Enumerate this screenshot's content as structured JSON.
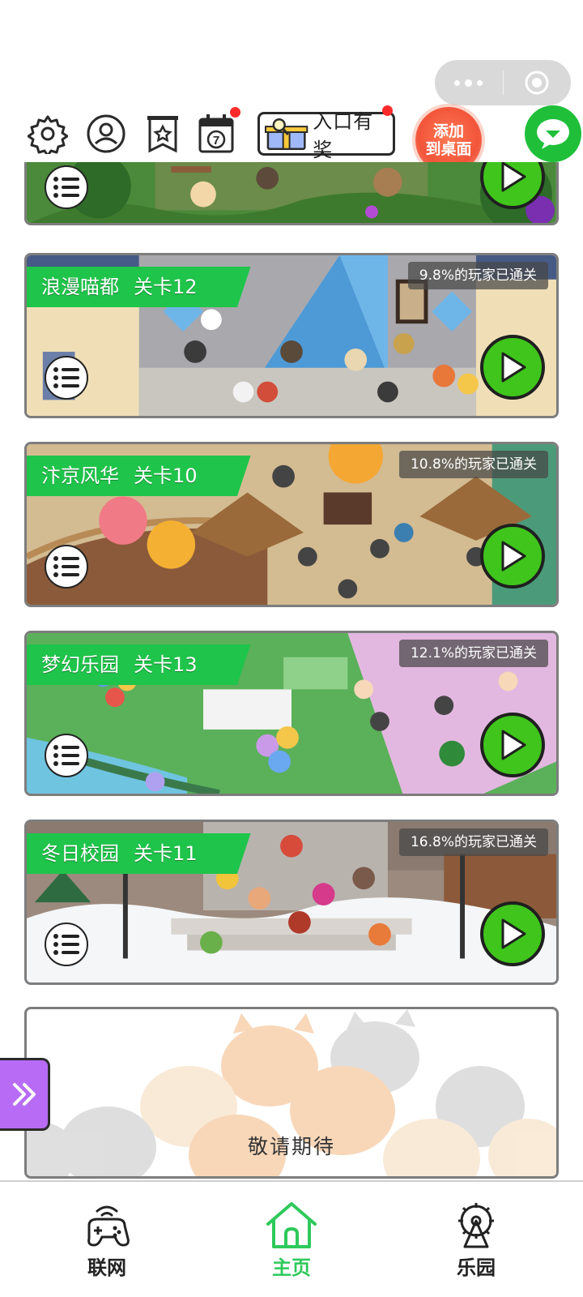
{
  "capsule": {
    "more_icon": "more-dots-icon",
    "close_icon": "target-circle-icon"
  },
  "topbar": {
    "settings_icon": "gear-icon",
    "profile_icon": "user-icon",
    "bookmark_icon": "star-bookmark-icon",
    "calendar_icon": "calendar-icon",
    "calendar_day": "7",
    "reward_label": "入口有奖",
    "add_desktop_line1": "添加",
    "add_desktop_line2": "到桌面",
    "chat_icon": "chat-bubble-icon"
  },
  "levels": [
    {
      "scene": "",
      "level": "",
      "pass_rate": "",
      "theme": "jungle"
    },
    {
      "scene": "浪漫喵都",
      "level": "关卡12",
      "pass_rate": "9.8%的玩家已通关",
      "theme": "paris"
    },
    {
      "scene": "汴京风华",
      "level": "关卡10",
      "pass_rate": "10.8%的玩家已通关",
      "theme": "bianjing"
    },
    {
      "scene": "梦幻乐园",
      "level": "关卡13",
      "pass_rate": "12.1%的玩家已通关",
      "theme": "park"
    },
    {
      "scene": "冬日校园",
      "level": "关卡11",
      "pass_rate": "16.8%的玩家已通关",
      "theme": "winter"
    }
  ],
  "coming_soon": "敬请期待",
  "side_tab_icon": "double-chevron-right-icon",
  "bottom_nav": [
    {
      "label": "联网",
      "icon": "gamepad-wifi-icon",
      "active": false
    },
    {
      "label": "主页",
      "icon": "home-icon",
      "active": true
    },
    {
      "label": "乐园",
      "icon": "ferris-wheel-icon",
      "active": false
    }
  ],
  "colors": {
    "accent_green": "#1fc44a",
    "play_green": "#3fc51b",
    "side_tab_purple": "#b86cf5",
    "add_desktop_red": "#f2553a"
  }
}
